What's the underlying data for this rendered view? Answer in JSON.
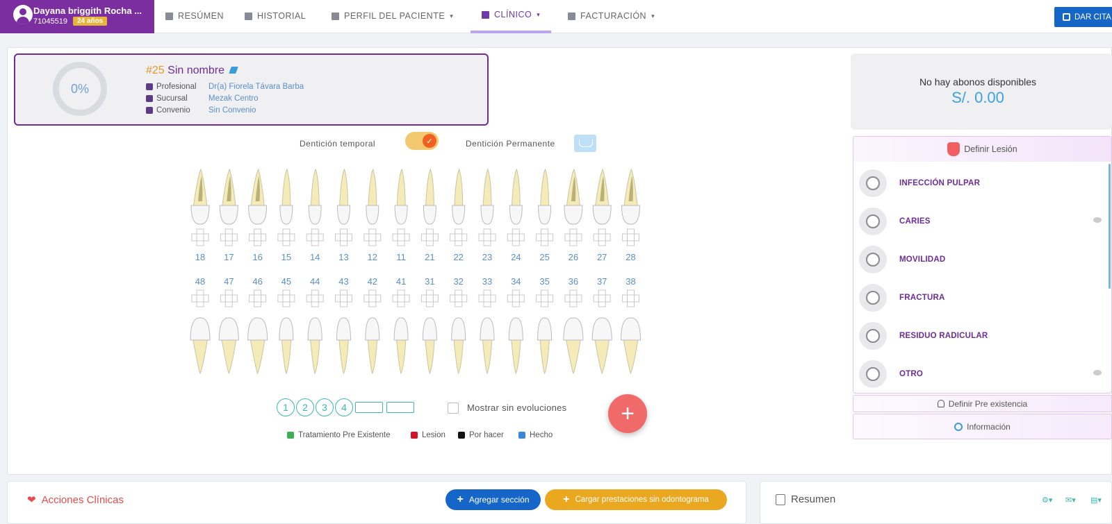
{
  "patient": {
    "name": "Dayana briggith Rocha ...",
    "doc": "71045519",
    "age": "24 años"
  },
  "nav": [
    {
      "label": "RESÚMEN",
      "caret": ""
    },
    {
      "label": "HISTORIAL",
      "caret": ""
    },
    {
      "label": "PERFIL DEL PACIENTE",
      "caret": "▾"
    },
    {
      "label": "CLÍNICO",
      "caret": "▾"
    },
    {
      "label": "FACTURACIÓN",
      "caret": "▾"
    }
  ],
  "dar_cita": "DAR CITA",
  "case": {
    "progress": "0%",
    "number": "#25",
    "name": "Sin nombre",
    "rows": [
      {
        "label": "Profesional",
        "value": "Dr(a) Fiorela Távara Barba"
      },
      {
        "label": "Sucursal",
        "value": "Mezak Centro"
      },
      {
        "label": "Convenio",
        "value": "Sin Convenio"
      }
    ]
  },
  "dentition": {
    "temporal": "Dentición temporal",
    "permanente": "Dentición Permanente"
  },
  "teeth": {
    "upper": [
      "18",
      "17",
      "16",
      "15",
      "14",
      "13",
      "12",
      "11",
      "21",
      "22",
      "23",
      "24",
      "25",
      "26",
      "27",
      "28"
    ],
    "lower": [
      "48",
      "47",
      "46",
      "45",
      "44",
      "43",
      "42",
      "41",
      "31",
      "32",
      "33",
      "34",
      "35",
      "36",
      "37",
      "38"
    ]
  },
  "quadrants": [
    "1",
    "2",
    "3",
    "4"
  ],
  "show_no_evol": "Mostrar sin evoluciones",
  "fab": "+",
  "legend": [
    {
      "label": "Tratamiento Pre Existente",
      "color": "#3fae54"
    },
    {
      "label": "Lesion",
      "color": "#d0152b"
    },
    {
      "label": "Por hacer",
      "color": "#111111"
    },
    {
      "label": "Hecho",
      "color": "#3a86d8"
    }
  ],
  "abono": {
    "title": "No hay abonos disponibles",
    "amount": "S/. 0.00"
  },
  "lesion": {
    "header": "Definir Lesión",
    "items": [
      "INFECCIÓN PULPAR",
      "CARIES",
      "MOVILIDAD",
      "FRACTURA",
      "RESIDUO RADICULAR",
      "OTRO"
    ]
  },
  "pre_existencia": "Definir Pre existencia",
  "informacion": "Información",
  "acciones": {
    "title": "Acciones Clínicas",
    "add": "Agregar sección",
    "load": "Cargar prestaciones sin odontograma"
  },
  "resumen": {
    "title": "Resumen"
  }
}
